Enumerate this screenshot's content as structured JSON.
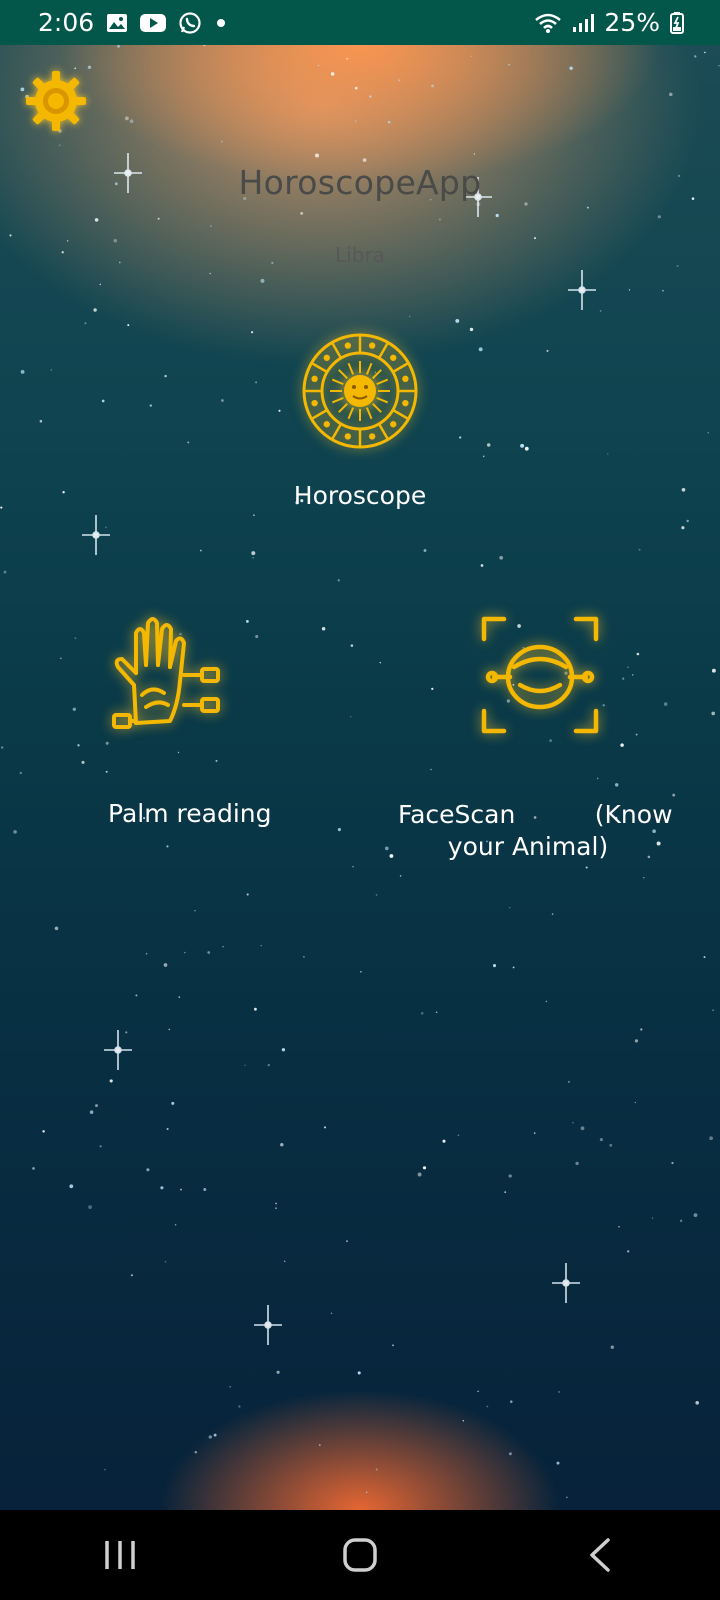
{
  "status_bar": {
    "time": "2:06",
    "battery_percent": "25%",
    "left_icons": [
      "image-icon",
      "youtube-icon",
      "whatsapp-icon",
      "dot-icon"
    ],
    "right_icons": [
      "wifi-icon",
      "signal-icon",
      "battery-icon"
    ]
  },
  "app": {
    "title": "HoroscopeApp",
    "sign": "Libra",
    "accent_color": "#f5b800"
  },
  "features": [
    {
      "label": "Horoscope",
      "icon": "zodiac-wheel-icon"
    },
    {
      "label": "Palm reading",
      "icon": "palm-icon"
    },
    {
      "label_line1": "FaceScan          (Know",
      "label_line2": "your Animal)",
      "icon": "face-scan-icon"
    }
  ],
  "navigation": [
    "recent-apps-icon",
    "home-icon",
    "back-icon"
  ]
}
